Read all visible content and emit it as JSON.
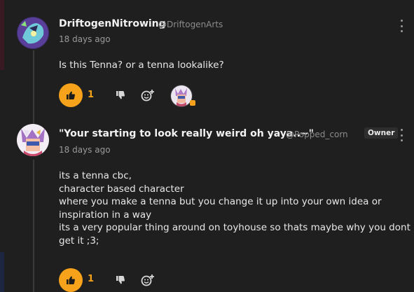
{
  "comments": [
    {
      "author": "DriftogenNitrowing",
      "handle": "@DriftogenArts",
      "time": "18 days ago",
      "lines": [
        "Is this Tenna? or a tenna lookalike?"
      ],
      "likes": "1"
    },
    {
      "author": "\"Your starting to look really weird oh yaya..~\"",
      "handle": "@Popped_corn",
      "badge": "Owner",
      "time": "18 days ago",
      "lines": [
        "its a tenna cbc,",
        "character based character",
        "where you make a tenna but you change it up into your own idea or",
        "inspiration in a way",
        "its a very popular thing around on toyhouse so thats maybe why you dont",
        "get it ;3;"
      ],
      "likes": "1"
    }
  ],
  "colors": {
    "accent": "#f6a21a",
    "background": "#1f1f1f"
  },
  "icons": [
    "thumbs-up-icon",
    "thumbs-down-icon",
    "add-reaction-icon",
    "more-options-icon"
  ]
}
